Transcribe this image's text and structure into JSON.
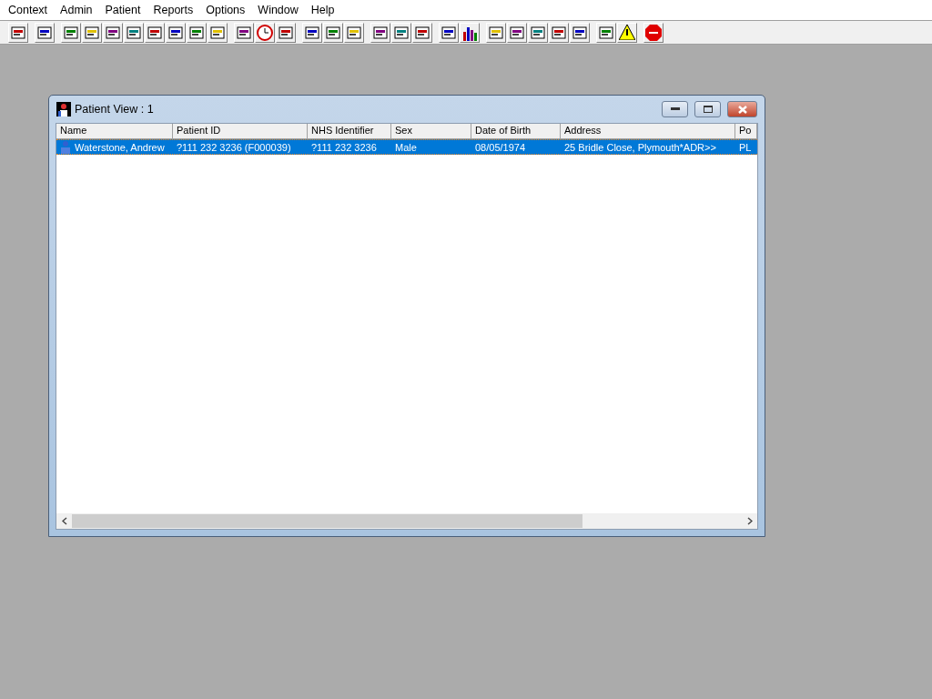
{
  "menu_bar": [
    "Context",
    "Admin",
    "Patient",
    "Reports",
    "Options",
    "Window",
    "Help"
  ],
  "window": {
    "title": "Patient View : 1"
  },
  "table": {
    "columns": [
      "Name",
      "Patient ID",
      "NHS Identifier",
      "Sex",
      "Date of Birth",
      "Address",
      "Po"
    ],
    "rows": [
      {
        "selected": true,
        "cells": [
          "Waterstone, Andrew",
          "?111 232 3236 (F000039)",
          "?111 232 3236",
          "Male",
          "08/05/1974",
          "25 Bridle Close, Plymouth*ADR>>",
          "PL"
        ]
      }
    ]
  }
}
